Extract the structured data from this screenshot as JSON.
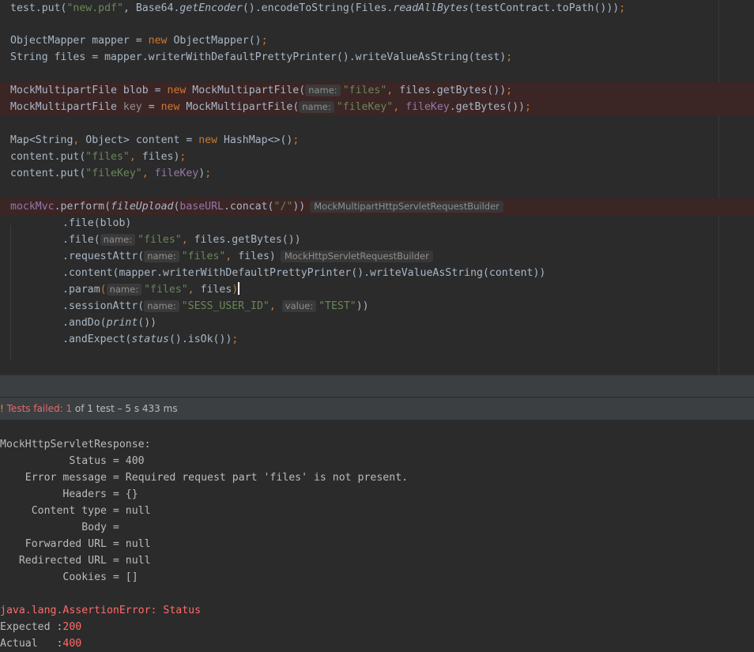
{
  "editor": {
    "line1": {
      "p1": "test.put(",
      "s1": "\"new.pdf\"",
      "p2": ", Base64.",
      "m1": "getEncoder",
      "p3": "().encodeToString(Files.",
      "m2": "readAllBytes",
      "p4": "(testContract.toPath()))",
      "semi": ";"
    },
    "line2": {
      "p1": "ObjectMapper mapper = ",
      "kw": "new",
      "p2": " ObjectMapper()",
      "semi": ";"
    },
    "line3": {
      "p1": "String files = mapper.writerWithDefaultPrettyPrinter().writeValueAsString(test)",
      "semi": ";"
    },
    "line4": {
      "p1": "MockMultipartFile blob = ",
      "kw": "new",
      "p2": " MockMultipartFile(",
      "hint": "name:",
      "s1": "\"files\"",
      "comma": ",",
      "p3": " files.getBytes())",
      "semi": ";"
    },
    "line5": {
      "p1": "MockMultipartFile ",
      "var": "key",
      "p2": " = ",
      "kw": "new",
      "p3": " MockMultipartFile(",
      "hint": "name:",
      "s1": "\"fileKey\"",
      "comma": ",",
      "fld": "fileKey",
      "p4": ".getBytes())",
      "semi": ";"
    },
    "line6": {
      "p1": "Map<String",
      "comma": ",",
      "p2": " Object> content = ",
      "kw": "new",
      "p3": " HashMap<>()",
      "semi": ";"
    },
    "line7": {
      "p1": "content.put(",
      "s1": "\"files\"",
      "comma": ",",
      "p2": " files)",
      "semi": ";"
    },
    "line8": {
      "p1": "content.put(",
      "s1": "\"fileKey\"",
      "comma": ",",
      "fld": "fileKey",
      "p2": ")",
      "semi": ";"
    },
    "line9": {
      "f1": "mockMvc",
      "p1": ".perform(",
      "m1": "fileUpload",
      "p2": "(",
      "f2": "baseURL",
      "p3": ".concat(",
      "s1": "\"/\"",
      "p4": "))",
      "type": "MockMultipartHttpServletRequestBuilder"
    },
    "line10": {
      "p1": ".file(blob)"
    },
    "line11": {
      "p1": ".file(",
      "hint": "name:",
      "s1": "\"files\"",
      "comma": ",",
      "p2": " files.getBytes())"
    },
    "line12": {
      "p1": ".requestAttr(",
      "hint": "name:",
      "s1": "\"files\"",
      "comma": ",",
      "p2": " files)",
      "type": "MockHttpServletRequestBuilder"
    },
    "line13": {
      "p1": ".content(mapper.writerWithDefaultPrettyPrinter().writeValueAsString(content))"
    },
    "line14": {
      "p1": ".param",
      "paren": "(",
      "hint": "name:",
      "s1": "\"files\"",
      "comma": ",",
      "p2": " files",
      "paren2": ")"
    },
    "line15": {
      "p1": ".sessionAttr(",
      "hint1": "name:",
      "s1": "\"SESS_USER_ID\"",
      "comma": ",",
      "hint2": "value:",
      "s2": "\"TEST\"",
      "p2": "))"
    },
    "line16": {
      "p1": ".andDo(",
      "m1": "print",
      "p2": "())"
    },
    "line17": {
      "p1": ".andExpect(",
      "m1": "status",
      "p2": "().isOk())",
      "semi": ";"
    }
  },
  "status_bar": {
    "icon": "!",
    "failed_label": "Tests failed: 1",
    "rest": " of 1 test – 5 s 433 ms"
  },
  "console": {
    "lines": [
      "MockHttpServletResponse:",
      "           Status = 400",
      "    Error message = Required request part 'files' is not present.",
      "          Headers = {}",
      "     Content type = null",
      "             Body = ",
      "    Forwarded URL = null",
      "   Redirected URL = null",
      "          Cookies = []"
    ],
    "error": "java.lang.AssertionError: Status",
    "expected_label": "Expected :",
    "expected_value": "200",
    "actual_label": "Actual   :",
    "actual_value": "400"
  },
  "colors": {
    "background": "#2b2b2b",
    "keyword": "#cc7832",
    "string": "#6a8759",
    "field": "#9876aa",
    "error_line": "#3b2525",
    "error_text": "#ff6b68"
  }
}
